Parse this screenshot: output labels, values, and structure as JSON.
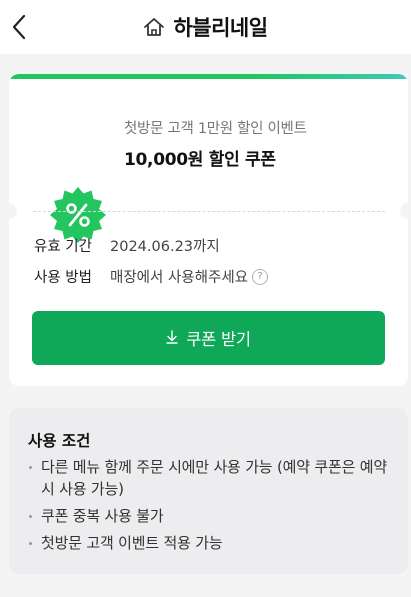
{
  "header": {
    "title": "하블리네일",
    "back_icon": "chevron-left-icon",
    "home_icon": "home-icon"
  },
  "coupon": {
    "badge_icon": "percent-icon",
    "badge_color": "#22c55e",
    "accent_color": "#0fa858",
    "event_name": "첫방문 고객 1만원 할인 이벤트",
    "title": "10,000원 할인 쿠폰",
    "validity_label": "유효 기간",
    "validity_value": "2024.06.23까지",
    "usage_label": "사용 방법",
    "usage_value": "매장에서 사용해주세요",
    "help_icon": "question-circle-icon",
    "button_label": "쿠폰 받기",
    "button_icon": "download-icon"
  },
  "conditions": {
    "title": "사용 조건",
    "items": [
      "다른 메뉴 함께 주문 시에만 사용 가능 (예약 쿠폰은 예약시 사용 가능)",
      "쿠폰 중복 사용 불가",
      "첫방문 고객 이벤트 적용 가능"
    ]
  }
}
